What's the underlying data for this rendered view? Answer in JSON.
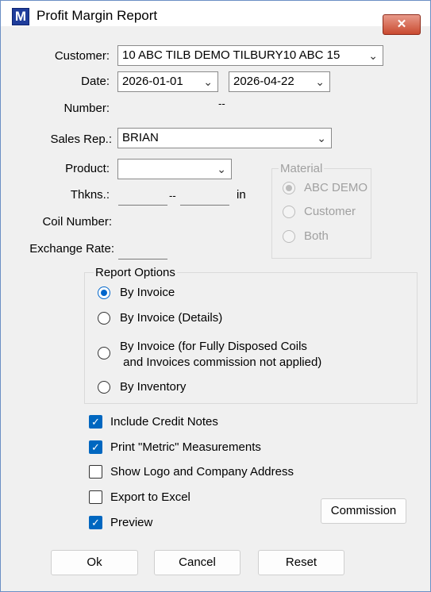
{
  "window": {
    "title": "Profit Margin Report",
    "icon_letter": "M",
    "close_glyph": "✕"
  },
  "form": {
    "customer_label": "Customer:",
    "customer_value": "10 ABC TILB DEMO  TILBURY10 ABC 15",
    "date_label": "Date:",
    "date_from": "2026-01-01",
    "date_to": "2026-04-22",
    "number_label": "Number:",
    "number_sep": "--",
    "sales_rep_label": "Sales Rep.:",
    "sales_rep_value": "BRIAN",
    "product_label": "Product:",
    "product_value": "",
    "thkns_label": "Thkns.:",
    "thkns_sep": "--",
    "thkns_unit": "in",
    "coil_label": "Coil Number:",
    "exchange_label": "Exchange Rate:"
  },
  "material": {
    "title": "Material",
    "options": [
      "ABC DEMO",
      "Customer",
      "Both"
    ],
    "selected": 0
  },
  "report_options": {
    "title": "Report Options",
    "options": [
      {
        "label": "By Invoice"
      },
      {
        "label": "By Invoice (Details)"
      },
      {
        "line1": "By Invoice (for Fully Disposed Coils",
        "line2": " and Invoices commission not applied)"
      },
      {
        "label": "By Inventory"
      }
    ],
    "selected": 0
  },
  "checkboxes": {
    "include_credit_notes": {
      "label": "Include Credit Notes",
      "checked": true
    },
    "print_metric": {
      "label": "Print \"Metric\" Measurements",
      "checked": true
    },
    "show_logo": {
      "label": "Show Logo and Company Address",
      "checked": false
    },
    "export_excel": {
      "label": "Export to Excel",
      "checked": false
    },
    "preview": {
      "label": "Preview",
      "checked": true
    }
  },
  "buttons": {
    "commission": "Commission",
    "ok": "Ok",
    "cancel": "Cancel",
    "reset": "Reset"
  },
  "icons": {
    "dropdown": "chevron-down-icon",
    "check": "✓"
  }
}
